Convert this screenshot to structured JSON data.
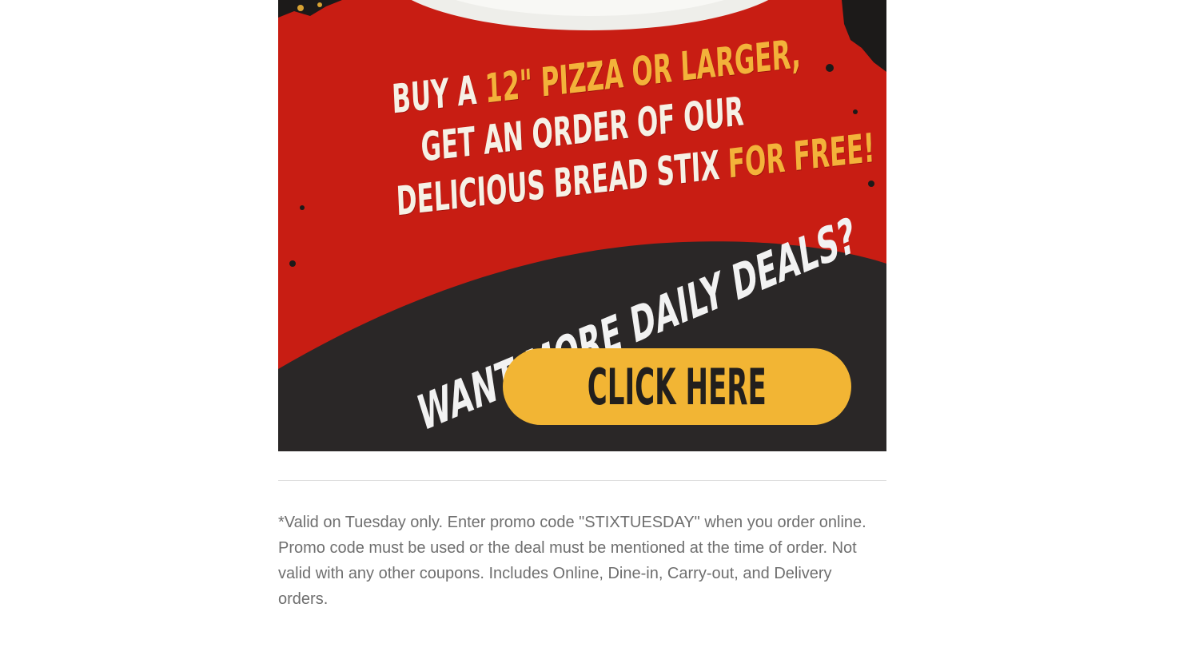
{
  "promo": {
    "headline": {
      "line1_white": "BUY A ",
      "line1_accent": "12\" PIZZA OR LARGER,",
      "line2": "GET AN ORDER OF OUR",
      "line3_white": "DELICIOUS BREAD STIX ",
      "line3_accent": "FOR FREE!"
    },
    "daily_deals": "WANT MORE DAILY DEALS?",
    "cta_label": "CLICK HERE"
  },
  "disclaimer": "*Valid on Tuesday only. Enter promo code \"STIXTUESDAY\" when you order online. Promo code must be used or the deal must be mentioned at the time of order. Not valid with any other coupons. Includes Online, Dine-in, Carry-out, and Delivery orders.",
  "colors": {
    "banner_red": "#c81d13",
    "banner_dark": "#2a2727",
    "accent_yellow": "#f3b23a",
    "button_yellow": "#f2b534",
    "text_cream": "#f6f1e6",
    "disclaimer_gray": "#6f6f6f"
  }
}
